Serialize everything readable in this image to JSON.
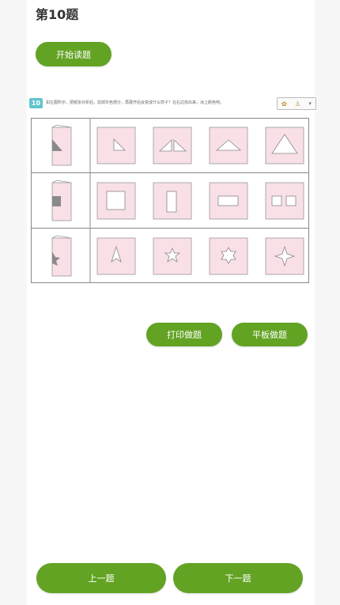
{
  "header": {
    "title": "第10题"
  },
  "actions": {
    "start_reading": "开始读题",
    "print": "打印做题",
    "tablet": "平板做题",
    "prev": "上一题",
    "next": "下一题"
  },
  "question": {
    "number": "10",
    "text": "如左图所示，把纸张对折后，剪掉灰色部分，再展开后会变成什么样子？在右边找出来，涂上颜色吧。"
  },
  "tools": {
    "icon1": "sun-icon",
    "icon2": "person-icon",
    "icon3": "chevron-down-icon"
  },
  "puzzle": {
    "rows": [
      {
        "fold_shape": "triangle",
        "options": [
          "small-triangle",
          "double-triangle",
          "wide-triangle",
          "big-triangle"
        ]
      },
      {
        "fold_shape": "rectangle",
        "options": [
          "square",
          "tall-rectangle",
          "wide-rectangle",
          "two-squares"
        ]
      },
      {
        "fold_shape": "star-half",
        "options": [
          "arrowhead",
          "five-point-star",
          "six-point-star",
          "four-point-star"
        ]
      }
    ]
  },
  "colors": {
    "accent": "#63a323",
    "badge": "#62c4cf",
    "cell_fill": "#f9dfe6",
    "shape_gray": "#8a8a8a"
  }
}
